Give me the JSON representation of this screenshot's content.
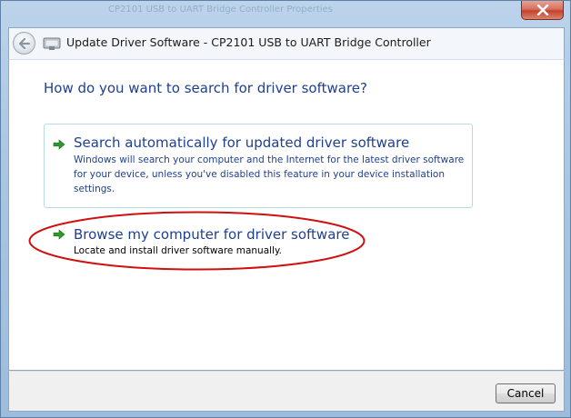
{
  "window": {
    "background_title": "CP2101 USB to UART Bridge Controller Properties",
    "title": "Update Driver Software - CP2101 USB to UART Bridge Controller"
  },
  "main": {
    "heading": "How do you want to search for driver software?",
    "options": [
      {
        "title": "Search automatically for updated driver software",
        "description": "Windows will search your computer and the Internet for the latest driver software for your device, unless you've disabled this feature in your device installation settings."
      },
      {
        "title": "Browse my computer for driver software",
        "description": "Locate and install driver software manually."
      }
    ]
  },
  "footer": {
    "cancel_label": "Cancel"
  },
  "colors": {
    "heading_blue": "#1f3f8f",
    "arrow_green": "#2e9a2e",
    "annotation_red": "#d01010"
  }
}
